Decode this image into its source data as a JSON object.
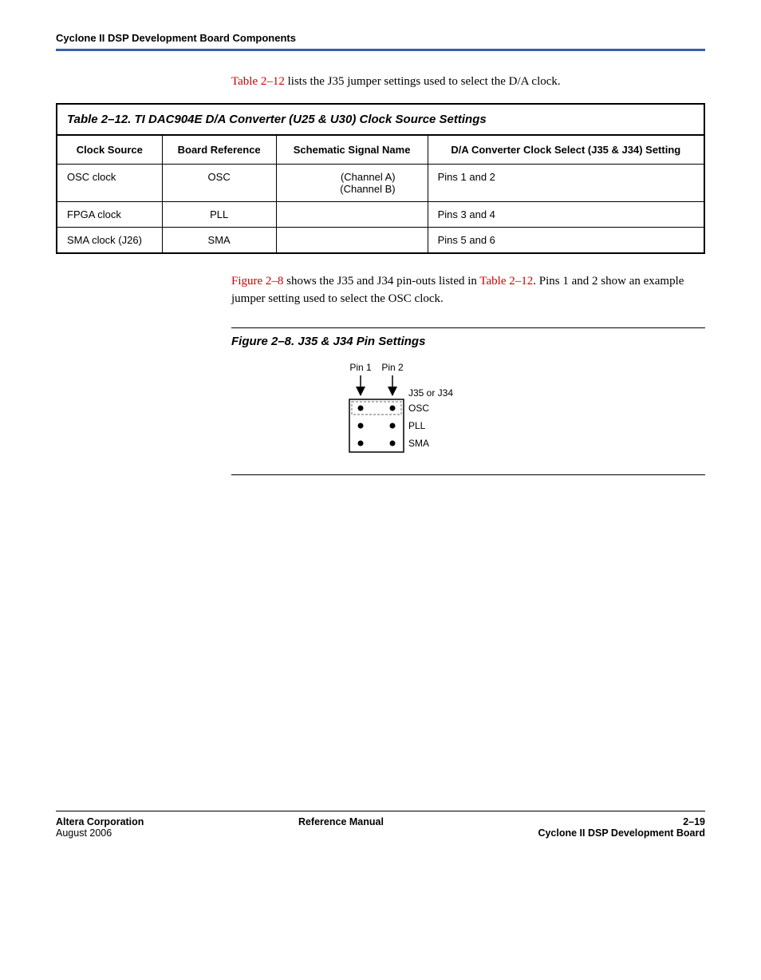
{
  "header": {
    "title": "Cyclone II DSP Development Board Components"
  },
  "intro": {
    "linkText": "Table 2–12",
    "rest": " lists the J35 jumper settings used to select the D/A clock."
  },
  "table": {
    "caption": "Table 2–12. TI DAC904E D/A Converter (U25 & U30) Clock Source Settings",
    "headers": {
      "c1": "Clock Source",
      "c2": "Board Reference",
      "c3": "Schematic Signal Name",
      "c4": "D/A Converter Clock Select (J35 & J34) Setting"
    },
    "rows": [
      {
        "src": "OSC clock",
        "ref": "OSC",
        "sigA": "(Channel A)",
        "sigB": "(Channel B)",
        "set": "Pins 1 and 2"
      },
      {
        "src": "FPGA clock",
        "ref": "PLL",
        "sigA": "",
        "sigB": "",
        "set": "Pins 3 and 4"
      },
      {
        "src": "SMA clock (J26)",
        "ref": "SMA",
        "sigA": "",
        "sigB": "",
        "set": "Pins 5 and 6"
      }
    ]
  },
  "para": {
    "flink": "Figure 2–8",
    "mid1": " shows the J35 and J34 pin-outs listed in ",
    "tlink": "Table 2–12",
    "mid2": ". Pins 1 and 2 show an example jumper setting used to select the OSC clock."
  },
  "figure": {
    "title": "Figure 2–8. J35 & J34 Pin Settings",
    "labels": {
      "pin1": "Pin 1",
      "pin2": "Pin 2",
      "hdr": "J35 or J34",
      "row1": "OSC",
      "row2": "PLL",
      "row3": "SMA"
    }
  },
  "footer": {
    "leftTop": "Altera Corporation",
    "leftBottom": "August 2006",
    "center": "Reference Manual",
    "rightTop": "2–19",
    "rightBottom": "Cyclone II DSP Development Board"
  }
}
